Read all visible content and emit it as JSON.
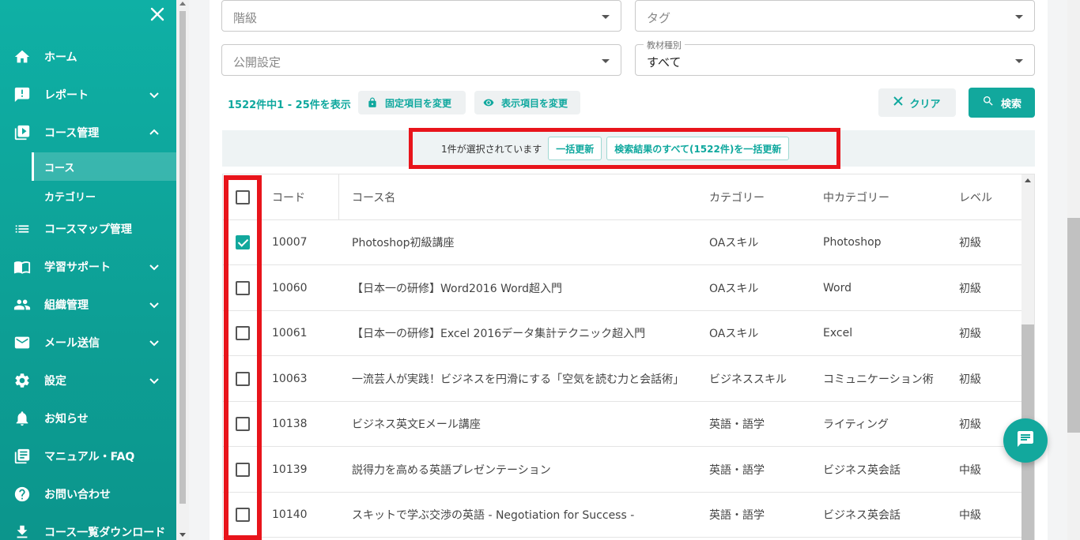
{
  "sidebar": {
    "items": [
      {
        "label": "ホーム",
        "icon": "home-icon"
      },
      {
        "label": "レポート",
        "icon": "report-icon",
        "expandable": true
      },
      {
        "label": "コース管理",
        "icon": "course-icon",
        "expandable": true,
        "expanded": true
      },
      {
        "label": "コースマップ管理",
        "icon": "list-icon"
      },
      {
        "label": "学習サポート",
        "icon": "book-icon",
        "expandable": true
      },
      {
        "label": "組織管理",
        "icon": "people-icon",
        "expandable": true
      },
      {
        "label": "メール送信",
        "icon": "mail-icon",
        "expandable": true
      },
      {
        "label": "設定",
        "icon": "gear-icon",
        "expandable": true
      },
      {
        "label": "お知らせ",
        "icon": "bell-icon"
      },
      {
        "label": "マニュアル・FAQ",
        "icon": "manual-icon"
      },
      {
        "label": "お問い合わせ",
        "icon": "help-icon"
      },
      {
        "label": "コース一覧ダウンロード",
        "icon": "download-icon"
      }
    ],
    "subitems": [
      {
        "label": "コース",
        "active": true
      },
      {
        "label": "カテゴリー",
        "active": false
      }
    ]
  },
  "filters": {
    "grade_placeholder": "階級",
    "tag_placeholder": "タグ",
    "publish_placeholder": "公開設定",
    "material_label": "教材種別",
    "material_value": "すべて"
  },
  "toolbar": {
    "count_text": "1522件中1 - 25件を表示",
    "fixed_items_label": "固定項目を変更",
    "display_items_label": "表示項目を変更",
    "clear_label": "クリア",
    "search_label": "検索"
  },
  "selection": {
    "text": "1件が選択されています",
    "bulk_update_label": "一括更新",
    "bulk_all_label": "検索結果のすべて(1522件)を一括更新"
  },
  "table": {
    "headers": {
      "code": "コード",
      "name": "コース名",
      "category": "カテゴリー",
      "subcategory": "中カテゴリー",
      "level": "レベル"
    },
    "rows": [
      {
        "checked": true,
        "code": "10007",
        "name": "Photoshop初級講座",
        "category": "OAスキル",
        "subcategory": "Photoshop",
        "level": "初級"
      },
      {
        "checked": false,
        "code": "10060",
        "name": "【日本一の研修】Word2016 Word超入門",
        "category": "OAスキル",
        "subcategory": "Word",
        "level": "初級"
      },
      {
        "checked": false,
        "code": "10061",
        "name": "【日本一の研修】Excel 2016データ集計テクニック超入門",
        "category": "OAスキル",
        "subcategory": "Excel",
        "level": "初級"
      },
      {
        "checked": false,
        "code": "10063",
        "name": "一流芸人が実践！ビジネスを円滑にする「空気を読む力と会話術」",
        "category": "ビジネススキル",
        "subcategory": "コミュニケーション術",
        "level": "初級"
      },
      {
        "checked": false,
        "code": "10138",
        "name": "ビジネス英文Eメール講座",
        "category": "英語・語学",
        "subcategory": "ライティング",
        "level": "初級"
      },
      {
        "checked": false,
        "code": "10139",
        "name": "説得力を高める英語プレゼンテーション",
        "category": "英語・語学",
        "subcategory": "ビジネス英会話",
        "level": "中級"
      },
      {
        "checked": false,
        "code": "10140",
        "name": "スキットで学ぶ交渉の英語 - Negotiation for Success -",
        "category": "英語・語学",
        "subcategory": "ビジネス英会話",
        "level": "中級"
      }
    ]
  },
  "colors": {
    "accent": "#12a89d",
    "highlight": "#e8141b"
  }
}
